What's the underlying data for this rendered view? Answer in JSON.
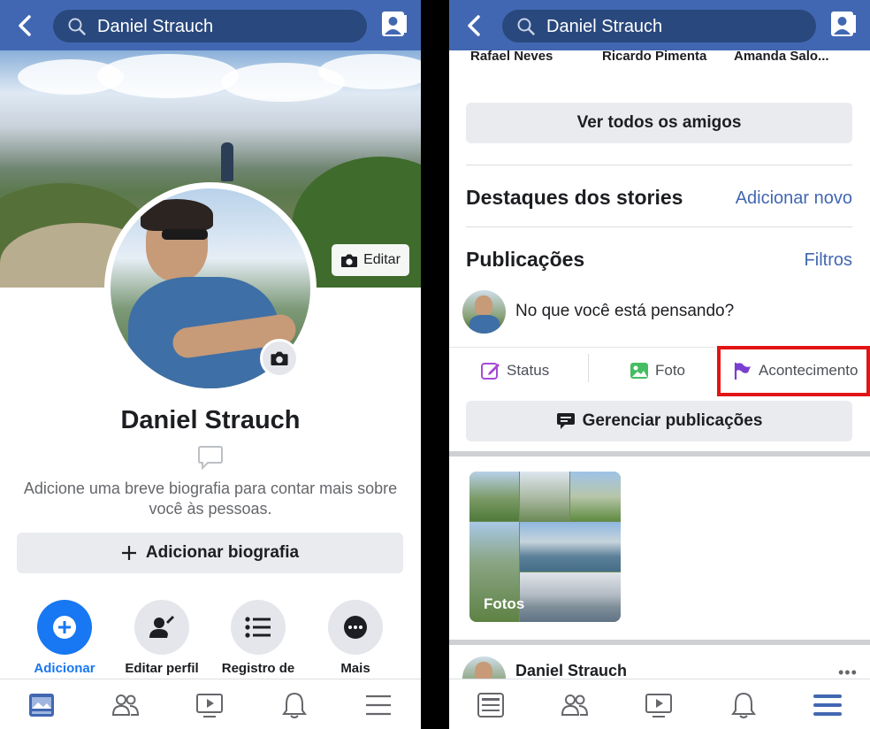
{
  "left": {
    "search_text": "Daniel Strauch",
    "cover_edit_label": "Editar",
    "profile_name": "Daniel Strauch",
    "bio_hint": "Adicione uma breve biografia para contar mais sobre você às pessoas.",
    "add_bio_label": "Adicionar biografia",
    "actions": [
      {
        "label": "Adicionar",
        "icon": "plus-icon",
        "color": "#1877f2"
      },
      {
        "label": "Editar perfil",
        "icon": "edit-profile-icon"
      },
      {
        "label": "Registro de",
        "icon": "list-icon"
      },
      {
        "label": "Mais",
        "icon": "more-icon"
      }
    ],
    "tabs": [
      "news-feed-icon",
      "friends-icon",
      "watch-icon",
      "notifications-icon",
      "menu-icon"
    ],
    "active_tab": "news-feed-icon"
  },
  "right": {
    "search_text": "Daniel Strauch",
    "friends": [
      "Rafael Neves",
      "Ricardo Pimenta",
      "Amanda Salo..."
    ],
    "see_all_friends": "Ver todos os amigos",
    "stories_title": "Destaques dos stories",
    "stories_link": "Adicionar novo",
    "posts_title": "Publicações",
    "posts_link": "Filtros",
    "composer_placeholder": "No que você está pensando?",
    "composer_options": [
      "Status",
      "Foto",
      "Acontecimento"
    ],
    "manage_posts": "Gerenciar publicações",
    "photos_label": "Fotos",
    "post_author": "Daniel Strauch",
    "active_tab": "menu-icon"
  },
  "colors": {
    "brand": "#4267b2",
    "search_bg": "#29487d",
    "link": "#4267b2",
    "highlight": "#e31414",
    "status_icon": "#a64ad8",
    "photo_icon": "#45bd62",
    "event_icon": "#7a3ed1"
  }
}
